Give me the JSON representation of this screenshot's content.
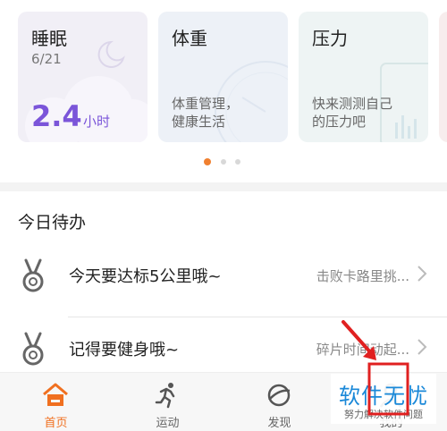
{
  "cards": [
    {
      "title": "睡眠",
      "date": "6/21",
      "value": "2.4",
      "unit": "小时"
    },
    {
      "title": "体重",
      "desc": "体重管理，\n健康生活"
    },
    {
      "title": "压力",
      "desc": "快来测测自己\n的压力吧"
    }
  ],
  "pager": {
    "total": 3,
    "active_index": 0
  },
  "todo": {
    "heading": "今日待办",
    "items": [
      {
        "title": "今天要达标5公里哦~",
        "hint": "击败卡路里挑..."
      },
      {
        "title": "记得要健身哦~",
        "hint": "碎片时间动起..."
      }
    ]
  },
  "tabs": [
    {
      "label": "首页",
      "icon": "home-icon",
      "active": true
    },
    {
      "label": "运动",
      "icon": "running-icon",
      "active": false
    },
    {
      "label": "发现",
      "icon": "discover-icon",
      "active": false
    },
    {
      "label": "我的",
      "icon": "profile-icon",
      "active": false
    }
  ],
  "watermark": {
    "title": "软件无忧",
    "subtitle": "努力解决软件问题"
  },
  "colors": {
    "accent": "#f07020",
    "sleep": "#7b55d9",
    "annotation": "#e02020"
  }
}
